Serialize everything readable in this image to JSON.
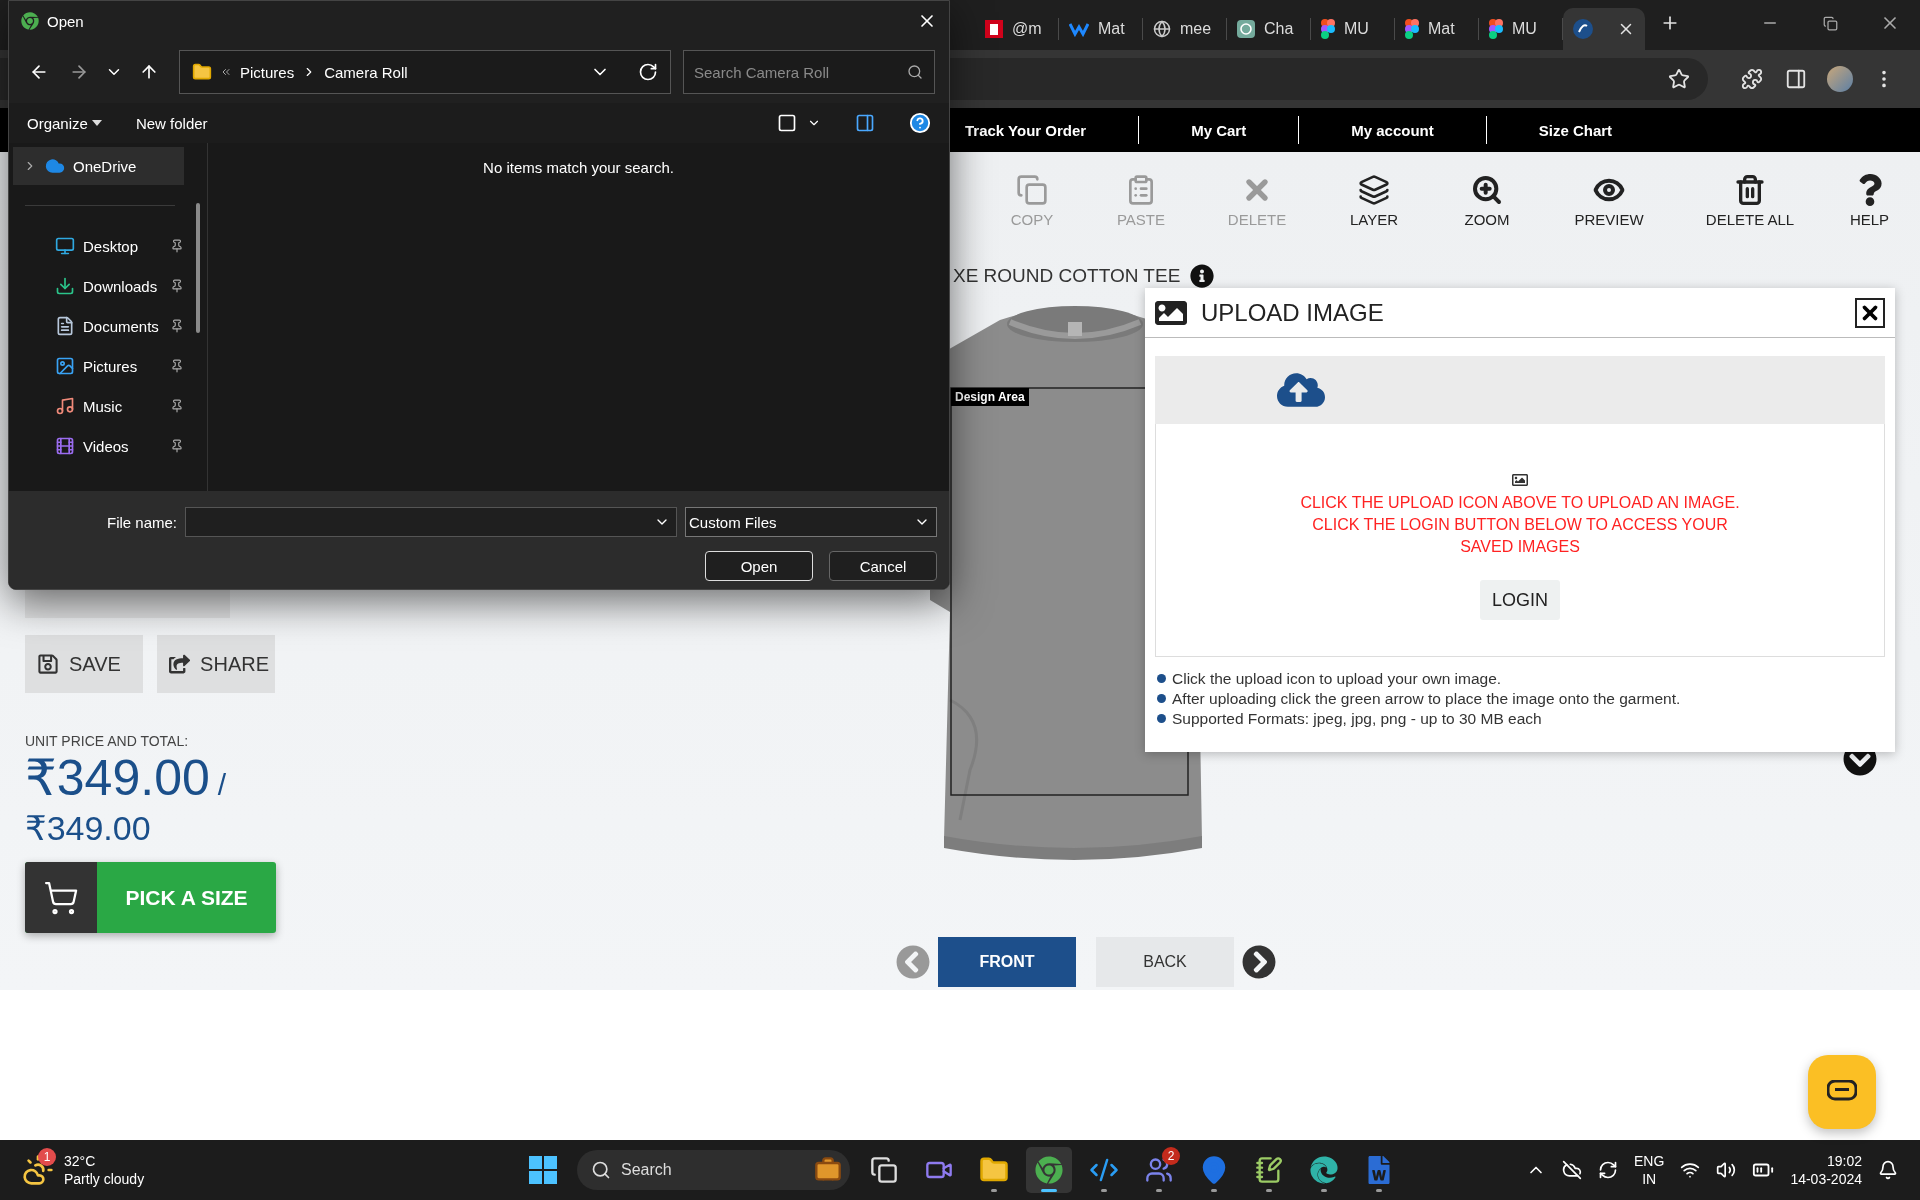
{
  "browser": {
    "tabs": [
      {
        "label": "@m",
        "selected": false
      },
      {
        "label": "Mat",
        "selected": false
      },
      {
        "label": "mee",
        "selected": false
      },
      {
        "label": "Cha",
        "selected": false
      },
      {
        "label": "MU",
        "selected": false
      },
      {
        "label": "Mat",
        "selected": false
      },
      {
        "label": "MU",
        "selected": false
      },
      {
        "selected": true
      }
    ]
  },
  "site_nav": [
    "Track Your Order",
    "My Cart",
    "My account",
    "Size Chart"
  ],
  "toolbar": [
    {
      "label": "COPY",
      "disabled": true
    },
    {
      "label": "PASTE",
      "disabled": true
    },
    {
      "label": "DELETE",
      "disabled": true
    },
    {
      "label": "LAYER",
      "disabled": false
    },
    {
      "label": "ZOOM",
      "disabled": false
    },
    {
      "label": "PREVIEW",
      "disabled": false
    },
    {
      "label": "DELETE ALL",
      "disabled": false
    },
    {
      "label": "HELP",
      "disabled": false
    }
  ],
  "product": {
    "title": "XE ROUND COTTON TEE",
    "design_area_label": "Design Area"
  },
  "left_panel": {
    "actions": [
      "SAVE",
      "SHARE"
    ],
    "price_label": "UNIT PRICE AND TOTAL:",
    "unit_price": "₹349.00",
    "separator": "/",
    "total": "₹349.00",
    "cart_button": "PICK A SIZE"
  },
  "views": [
    {
      "label": "FRONT",
      "selected": true
    },
    {
      "label": "BACK",
      "selected": false
    }
  ],
  "upload_modal": {
    "title": "UPLOAD IMAGE",
    "message": "CLICK THE UPLOAD ICON ABOVE TO UPLOAD AN IMAGE. CLICK THE LOGIN BUTTON BELOW TO ACCESS YOUR SAVED IMAGES",
    "login": "LOGIN",
    "tips": [
      "Click the upload icon to upload your own image.",
      "After uploading click the green arrow to place the image onto the garment.",
      "Supported Formats: jpeg, jpg, png - up to 30 MB each"
    ]
  },
  "file_dialog": {
    "title": "Open",
    "path": [
      "Pictures",
      "Camera Roll"
    ],
    "search_placeholder": "Search Camera Roll",
    "organize": "Organize",
    "new_folder": "New folder",
    "nav": [
      {
        "label": "OneDrive",
        "selected": true,
        "pinned": false
      },
      {
        "label": "Desktop",
        "selected": false,
        "pinned": true
      },
      {
        "label": "Downloads",
        "selected": false,
        "pinned": true
      },
      {
        "label": "Documents",
        "selected": false,
        "pinned": true
      },
      {
        "label": "Pictures",
        "selected": false,
        "pinned": true
      },
      {
        "label": "Music",
        "selected": false,
        "pinned": true
      },
      {
        "label": "Videos",
        "selected": false,
        "pinned": true
      }
    ],
    "empty_message": "No items match your search.",
    "file_name_label": "File name:",
    "file_type": "Custom Files",
    "buttons": [
      "Open",
      "Cancel"
    ]
  },
  "taskbar": {
    "weather": {
      "badge": "1",
      "temperature": "32°C",
      "condition": "Partly cloudy"
    },
    "search": "Search",
    "apps": [
      {
        "running": false,
        "active": false
      },
      {
        "running": false,
        "active": false
      },
      {
        "running": true,
        "active": false
      },
      {
        "running": true,
        "active": true
      },
      {
        "running": true,
        "active": false
      },
      {
        "running": true,
        "active": false,
        "badge": "2"
      },
      {
        "running": true,
        "active": false
      },
      {
        "running": true,
        "active": false
      },
      {
        "running": true,
        "active": false
      },
      {
        "running": true,
        "active": false
      }
    ],
    "language": "ENG",
    "region": "IN",
    "time": "19:02",
    "date": "14-03-2024"
  }
}
